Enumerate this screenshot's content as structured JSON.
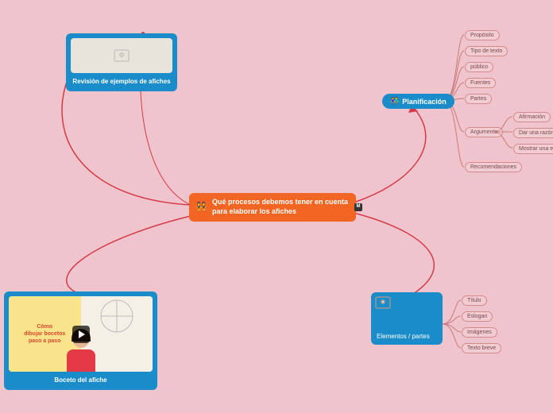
{
  "central": {
    "title": "Qué procesos debemos tener en cuenta para elaborar los afiches",
    "emoji": "👯"
  },
  "branches": {
    "revision": {
      "label": "Revisión de ejemplos de afiches"
    },
    "boceto": {
      "label": "Boceto del afiche",
      "thumb_line1": "Cómo",
      "thumb_line2": "dibujar bocetos",
      "thumb_line3": "paso a paso"
    },
    "planificacion": {
      "label": "Planificación",
      "emoji": "👫",
      "children": {
        "proposito": "Propósito",
        "tipo": "Tipo de texto",
        "publico": "público",
        "fuentes": "Fuentes",
        "partes": "Partes",
        "argumento": {
          "label": "Argumento",
          "children": {
            "afirmacion": "Afirmación",
            "razon": "Dar una razón",
            "evidencia": "Mostrar una evid"
          }
        },
        "recomendaciones": "Recomendaciones"
      }
    },
    "elementos": {
      "label": "Elementos / partes",
      "children": {
        "titulo": "Título",
        "eslogan": "Eslogan",
        "imagenes": "Imágenes",
        "texto": "Texto breve"
      }
    }
  }
}
